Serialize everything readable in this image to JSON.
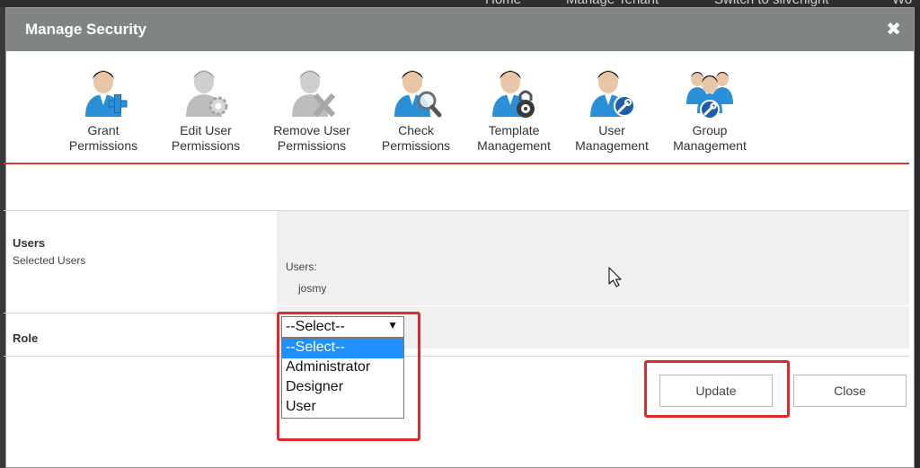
{
  "background_nav": [
    "Home",
    "Manage Tenant",
    "Switch to silverlight",
    "Wo"
  ],
  "modal": {
    "title": "Manage Security",
    "close_glyph": "✖"
  },
  "toolbar": [
    {
      "label_1": "Grant",
      "label_2": "Permissions",
      "icon": "user-add-icon",
      "enabled": true
    },
    {
      "label_1": "Edit User",
      "label_2": "Permissions",
      "icon": "user-gear-icon",
      "enabled": false
    },
    {
      "label_1": "Remove User",
      "label_2": "Permissions",
      "icon": "user-remove-icon",
      "enabled": false
    },
    {
      "label_1": "Check",
      "label_2": "Permissions",
      "icon": "user-search-icon",
      "enabled": true
    },
    {
      "label_1": "Template",
      "label_2": "Management",
      "icon": "user-lock-icon",
      "enabled": true
    },
    {
      "label_1": "User",
      "label_2": "Management",
      "icon": "user-wrench-icon",
      "enabled": true
    },
    {
      "label_1": "Group",
      "label_2": "Management",
      "icon": "group-wrench-icon",
      "enabled": true
    }
  ],
  "form": {
    "users_label": "Users",
    "users_sub": "Selected Users",
    "users_field_label": "Users:",
    "users_value": "josmy",
    "role_label": "Role",
    "role_selected": "--Select--",
    "role_options": [
      "--Select--",
      "Administrator",
      "Designer",
      "User"
    ],
    "arrow_glyph": "▼"
  },
  "buttons": {
    "update": "Update",
    "close": "Close"
  },
  "colors": {
    "header": "#808485",
    "accent_rule": "#e0322f",
    "highlight": "#e02a2a",
    "selected_option": "#1e90ff",
    "icon_blue": "#2a8fd6"
  }
}
